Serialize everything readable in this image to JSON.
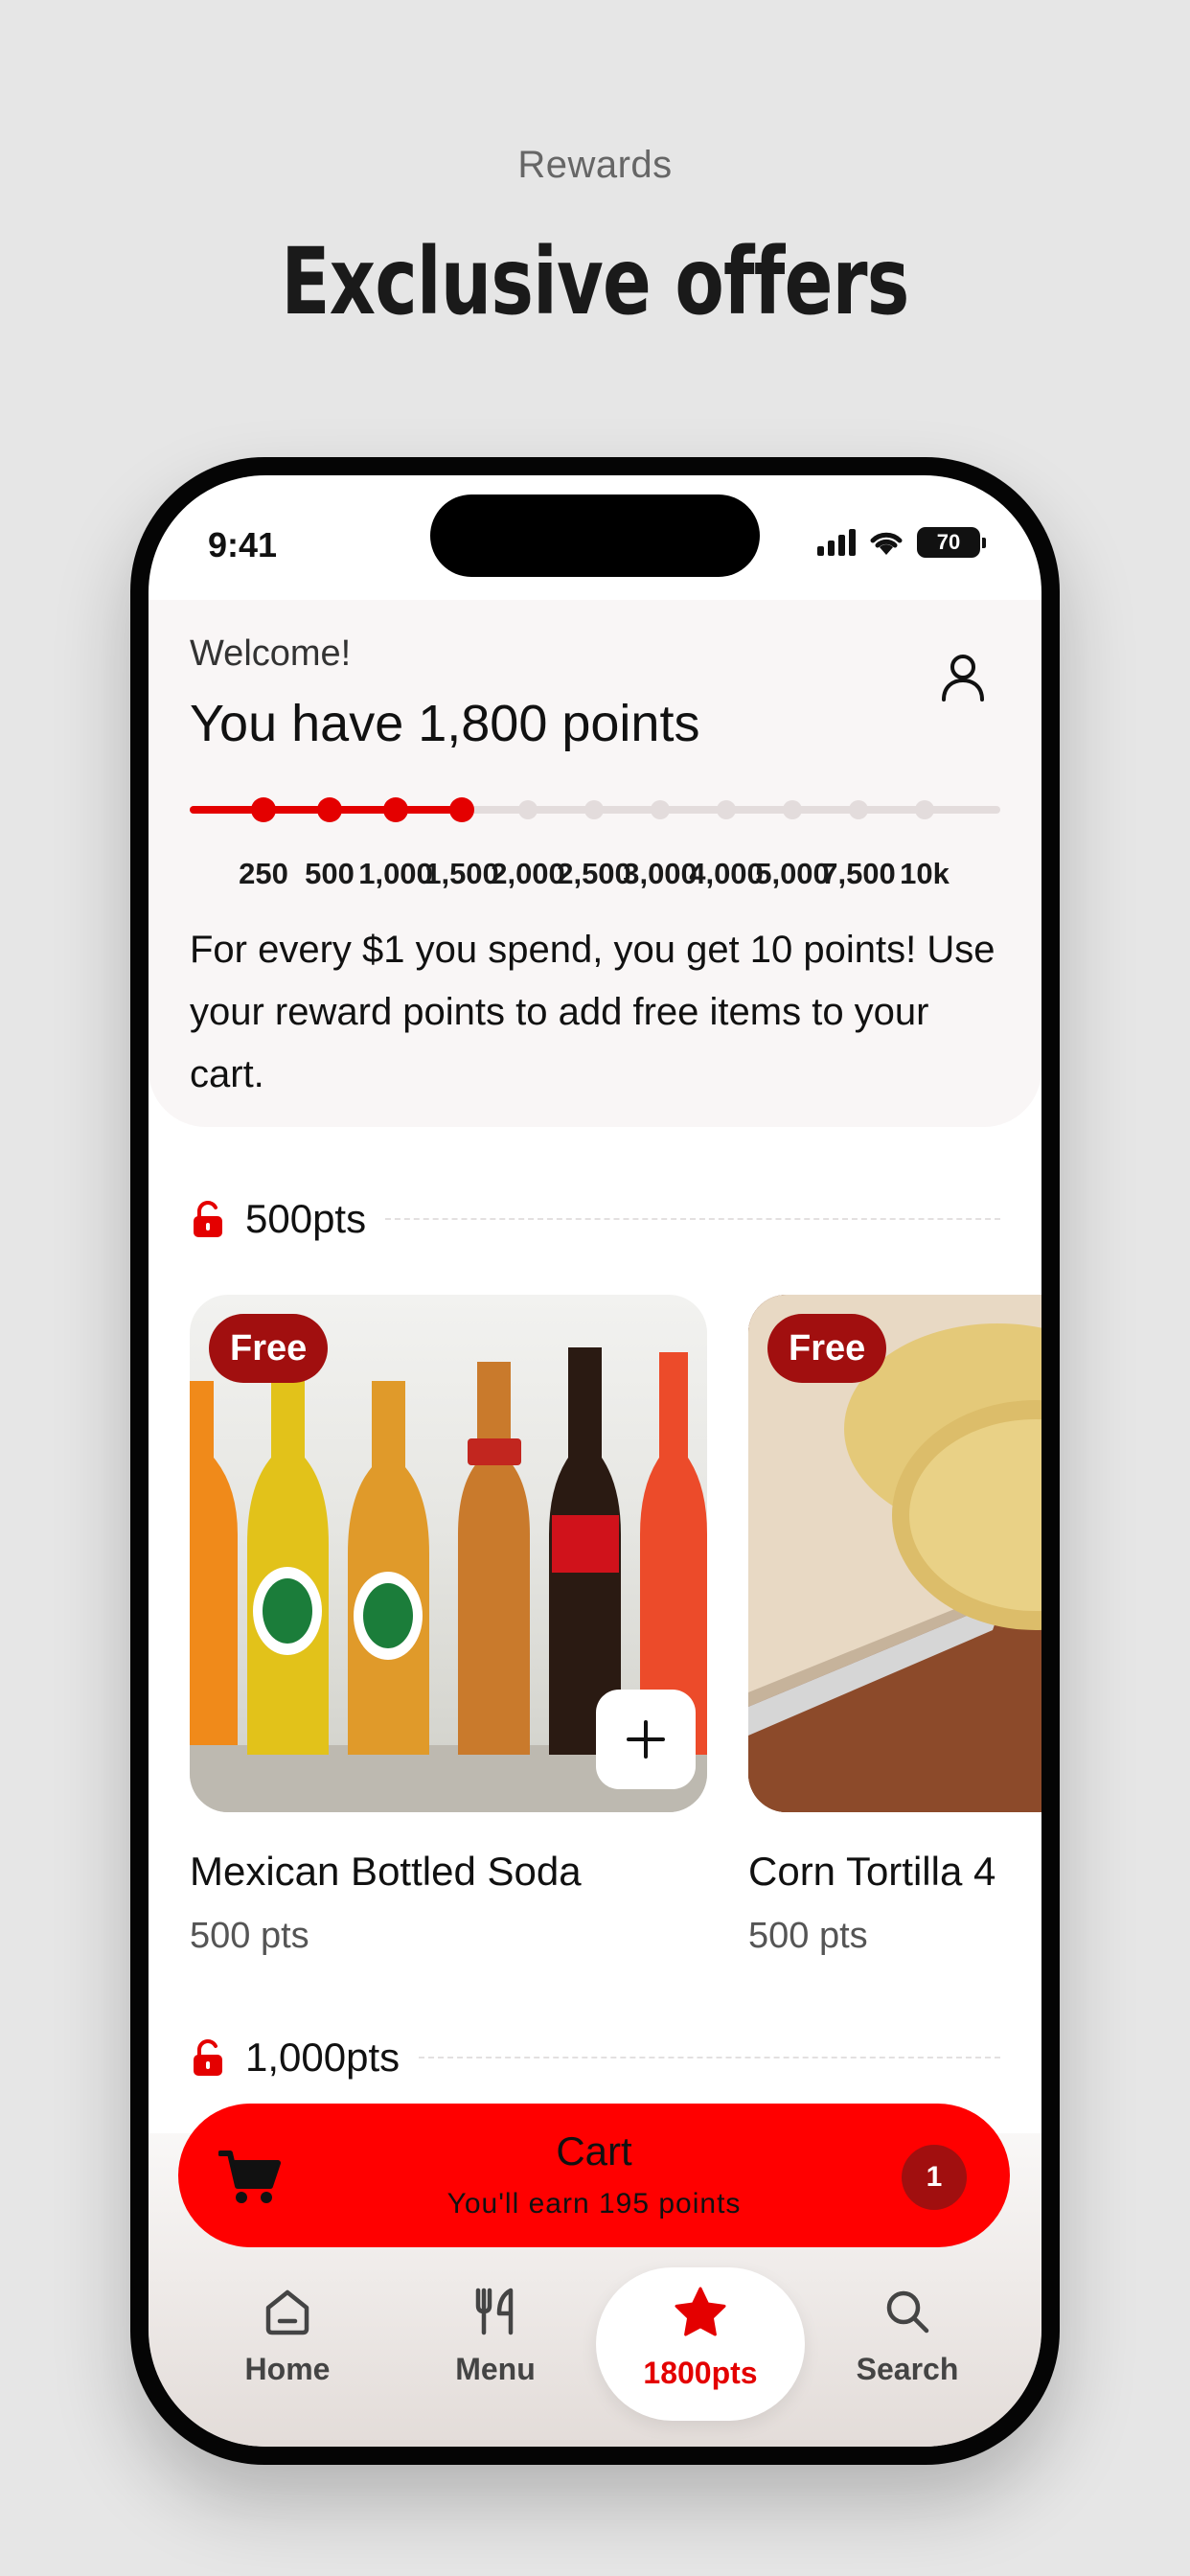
{
  "promo": {
    "eyebrow": "Rewards",
    "title": "Exclusive offers"
  },
  "status_bar": {
    "time": "9:41",
    "battery": "70"
  },
  "header": {
    "welcome": "Welcome!",
    "points_heading": "You have 1,800 points",
    "account_icon": "person-icon"
  },
  "progress": {
    "current_points": 1800,
    "milestones": [
      "250",
      "500",
      "1,000",
      "1,500",
      "2,000",
      "2,500",
      "3,000",
      "4,000",
      "5,000",
      "7,500",
      "10k"
    ],
    "reached_count": 4
  },
  "info_text": "For every $1 you spend, you get 10 points! Use your reward points to add free items to your cart.",
  "sections": [
    {
      "label": "500pts",
      "products": [
        {
          "badge": "Free",
          "name": "Mexican Bottled Soda",
          "points": "500 pts"
        },
        {
          "badge": "Free",
          "name": "Corn Tortilla 4",
          "points": "500 pts"
        }
      ]
    },
    {
      "label": "1,000pts"
    }
  ],
  "cart": {
    "title": "Cart",
    "subtitle": "You'll earn 195 points",
    "count": "1"
  },
  "tabs": [
    {
      "label": "Home",
      "icon": "home-icon"
    },
    {
      "label": "Menu",
      "icon": "utensils-icon"
    },
    {
      "label": "1800pts",
      "icon": "star-icon",
      "active": true
    },
    {
      "label": "Search",
      "icon": "search-icon"
    }
  ],
  "colors": {
    "accent": "#ff0000",
    "brand_red": "#e40000",
    "badge": "#a10f0f",
    "background": "#e6e6e6"
  }
}
